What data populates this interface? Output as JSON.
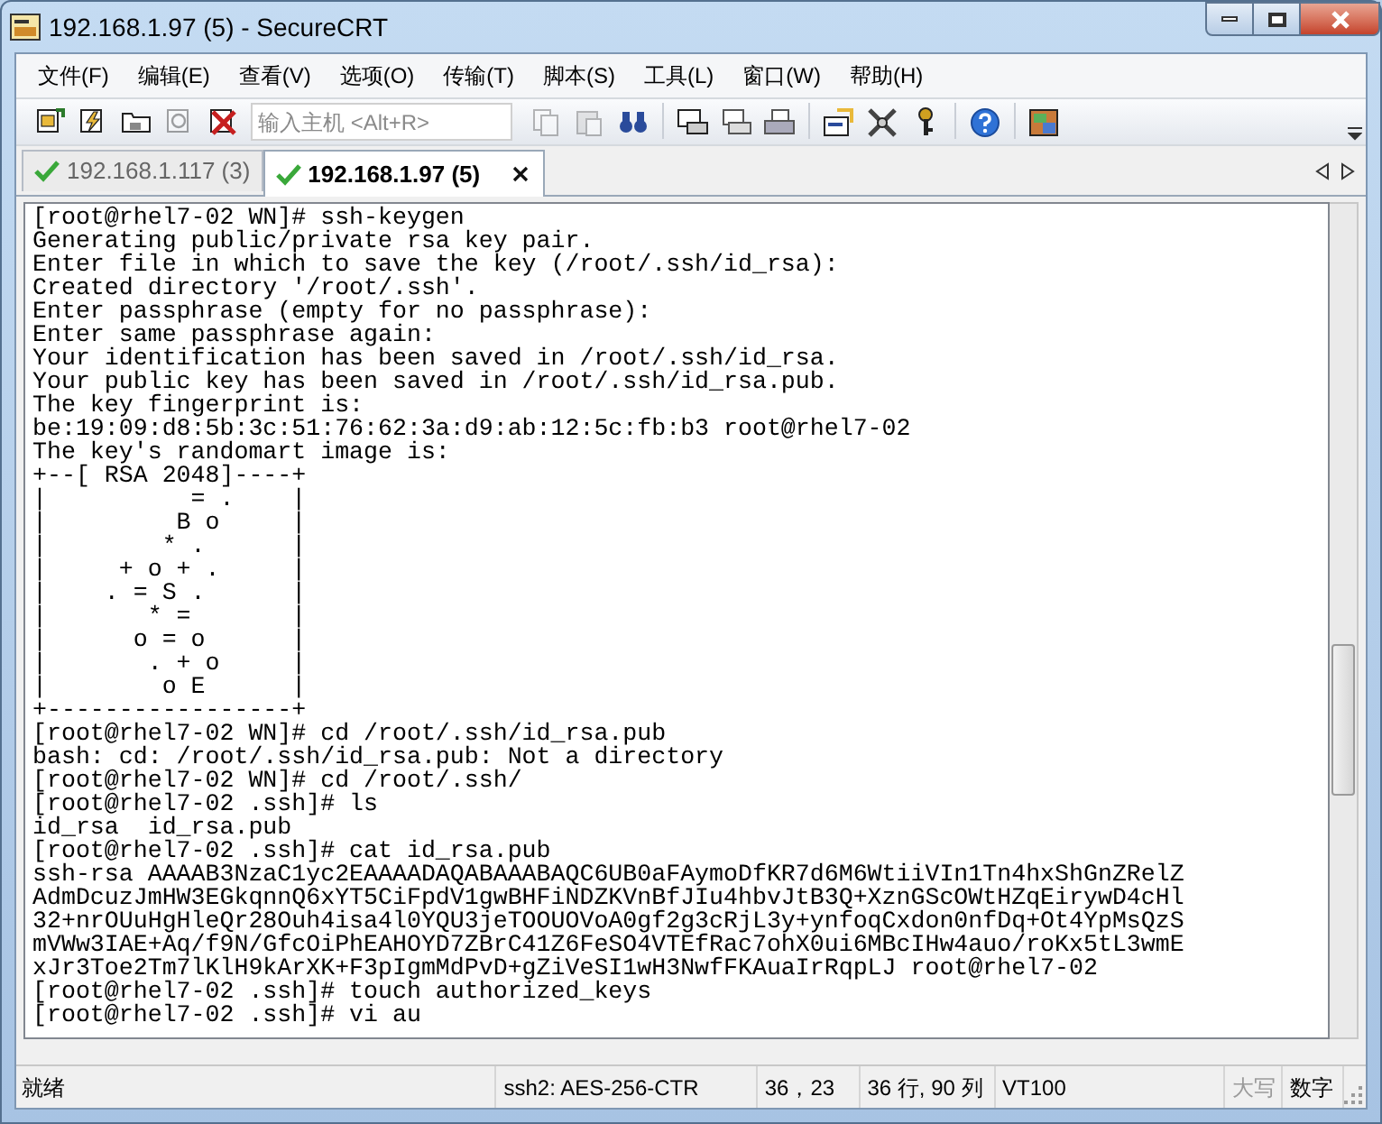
{
  "window": {
    "title": "192.168.1.97 (5) - SecureCRT"
  },
  "menu": [
    {
      "label": "文件(F)"
    },
    {
      "label": "编辑(E)"
    },
    {
      "label": "查看(V)"
    },
    {
      "label": "选项(O)"
    },
    {
      "label": "传输(T)"
    },
    {
      "label": "脚本(S)"
    },
    {
      "label": "工具(L)"
    },
    {
      "label": "窗口(W)"
    },
    {
      "label": "帮助(H)"
    }
  ],
  "toolbar_left": [
    {
      "kind": "connect",
      "disabled": false
    },
    {
      "kind": "quick",
      "disabled": false
    },
    {
      "kind": "folder",
      "disabled": false
    },
    {
      "kind": "reconnect",
      "disabled": true
    },
    {
      "kind": "disconnect",
      "disabled": false
    }
  ],
  "host_field": {
    "placeholder": "输入主机 <Alt+R>"
  },
  "toolbar_right": [
    {
      "kind": "copy",
      "disabled": true
    },
    {
      "kind": "paste",
      "disabled": true
    },
    {
      "kind": "find",
      "disabled": false
    },
    {
      "kind": "print-screen",
      "disabled": false
    },
    {
      "kind": "print-selection",
      "disabled": false
    },
    {
      "kind": "printer",
      "disabled": false
    },
    {
      "kind": "properties",
      "disabled": false
    },
    {
      "kind": "tools",
      "disabled": false
    },
    {
      "kind": "key",
      "disabled": false
    },
    {
      "kind": "help",
      "disabled": false
    },
    {
      "kind": "map",
      "disabled": false
    }
  ],
  "tabs": [
    {
      "label": "192.168.1.117 (3)",
      "connected": true,
      "selected": false
    },
    {
      "label": "192.168.1.97 (5)",
      "connected": true,
      "selected": true
    }
  ],
  "terminal": {
    "lines": [
      "[root@rhel7-02 WN]# ssh-keygen",
      "Generating public/private rsa key pair.",
      "Enter file in which to save the key (/root/.ssh/id_rsa):",
      "Created directory '/root/.ssh'.",
      "Enter passphrase (empty for no passphrase):",
      "Enter same passphrase again:",
      "Your identification has been saved in /root/.ssh/id_rsa.",
      "Your public key has been saved in /root/.ssh/id_rsa.pub.",
      "The key fingerprint is:",
      "be:19:09:d8:5b:3c:51:76:62:3a:d9:ab:12:5c:fb:b3 root@rhel7-02",
      "The key's randomart image is:",
      "+--[ RSA 2048]----+",
      "|          = .    |",
      "|         B o     |",
      "|        * .      |",
      "|     + o + .     |",
      "|    . = S .      |",
      "|       * =       |",
      "|      o = o      |",
      "|       . + o     |",
      "|        o E      |",
      "+-----------------+",
      "[root@rhel7-02 WN]# cd /root/.ssh/id_rsa.pub",
      "bash: cd: /root/.ssh/id_rsa.pub: Not a directory",
      "[root@rhel7-02 WN]# cd /root/.ssh/",
      "[root@rhel7-02 .ssh]# ls",
      "id_rsa  id_rsa.pub",
      "[root@rhel7-02 .ssh]# cat id_rsa.pub",
      "ssh-rsa AAAAB3NzaC1yc2EAAAADAQABAAABAQC6UB0aFAymoDfKR7d6M6WtiiVIn1Tn4hxShGnZRelZ",
      "AdmDcuzJmHW3EGkqnnQ6xYT5CiFpdV1gwBHFiNDZKVnBfJIu4hbvJtB3Q+XznGScOWtHZqEirywD4cHl",
      "32+nrOUuHgHleQr28Ouh4isa4l0YQU3jeTOOUOVoA0gf2g3cRjL3y+ynfoqCxdon0nfDq+Ot4YpMsQzS",
      "mVWw3IAE+Aq/f9N/GfcOiPhEAHOYD7ZBrC41Z6FeSO4VTEfRac7ohX0ui6MBcIHw4auo/roKx5tL3wmE",
      "xJr3Toe2Tm7lKlH9kArXK+F3pIgmMdPvD+gZiVeSI1wH3NwfFKAuaIrRqpLJ root@rhel7-02",
      "[root@rhel7-02 .ssh]# touch authorized_keys",
      "[root@rhel7-02 .ssh]# vi au"
    ]
  },
  "status_bar": [
    {
      "text": "就绪",
      "disabled": false
    },
    {
      "text": "ssh2: AES-256-CTR",
      "disabled": false
    },
    {
      "text": "36，23",
      "disabled": false
    },
    {
      "text": "36 行, 90 列",
      "disabled": false
    },
    {
      "text": "VT100",
      "disabled": false
    },
    {
      "text": "大写",
      "disabled": true
    },
    {
      "text": "数字",
      "disabled": false
    }
  ]
}
